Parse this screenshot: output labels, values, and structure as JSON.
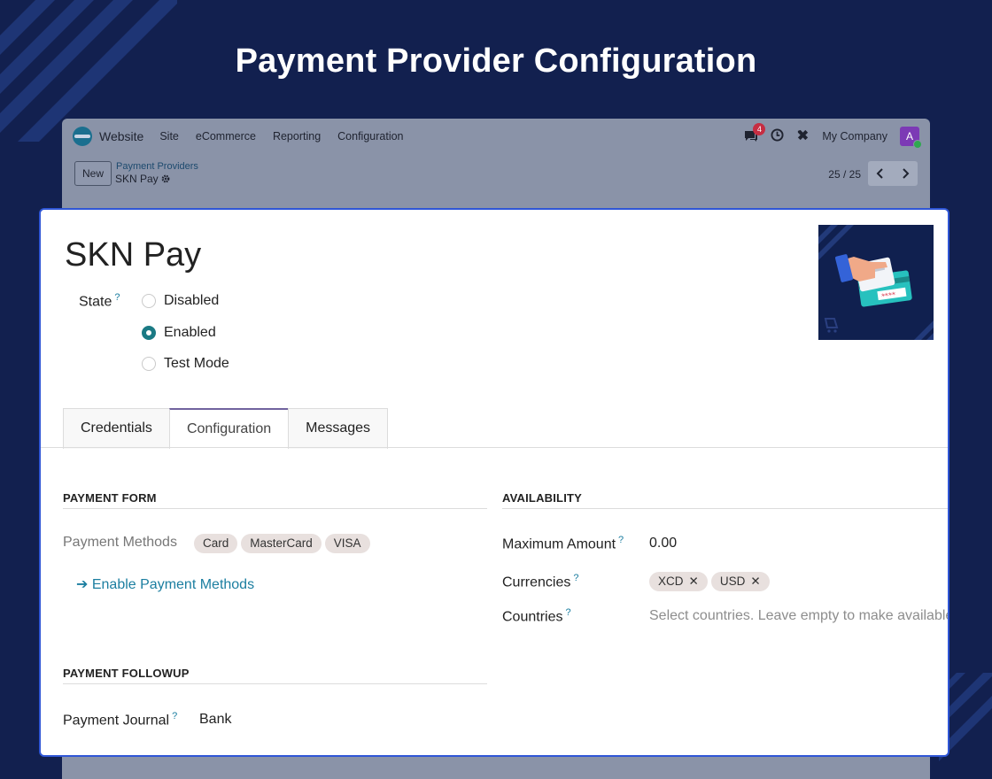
{
  "hero": {
    "title": "Payment Provider Configuration"
  },
  "app": {
    "brand": "Website",
    "menu": [
      "Site",
      "eCommerce",
      "Reporting",
      "Configuration"
    ],
    "chat_count": "4",
    "company": "My Company",
    "avatar_letter": "A",
    "new_button": "New",
    "breadcrumb_parent": "Payment Providers",
    "breadcrumb_current": "SKN Pay",
    "pager": "25 / 25"
  },
  "form": {
    "title": "SKN Pay",
    "state_label": "State",
    "help_mark": "?",
    "state_options": [
      {
        "label": "Disabled",
        "checked": false
      },
      {
        "label": "Enabled",
        "checked": true
      },
      {
        "label": "Test Mode",
        "checked": false
      }
    ],
    "tabs": [
      {
        "label": "Credentials",
        "active": false
      },
      {
        "label": "Configuration",
        "active": true
      },
      {
        "label": "Messages",
        "active": false
      }
    ],
    "payment_form": {
      "heading": "PAYMENT FORM",
      "methods_label": "Payment Methods",
      "methods": [
        "Card",
        "MasterCard",
        "VISA"
      ],
      "enable_link": "Enable Payment Methods"
    },
    "availability": {
      "heading": "AVAILABILITY",
      "max_amount_label": "Maximum Amount",
      "max_amount_value": "0.00",
      "currencies_label": "Currencies",
      "currencies": [
        "XCD",
        "USD"
      ],
      "countries_label": "Countries",
      "countries_placeholder": "Select countries. Leave empty to make available everywhere."
    },
    "payment_followup": {
      "heading": "PAYMENT FOLLOWUP",
      "journal_label": "Payment Journal",
      "journal_value": "Bank"
    }
  },
  "colors": {
    "background": "#12204f",
    "highlight_border": "#2f56d6",
    "accent_teal": "#1b7a84",
    "link": "#1b7ea0"
  }
}
